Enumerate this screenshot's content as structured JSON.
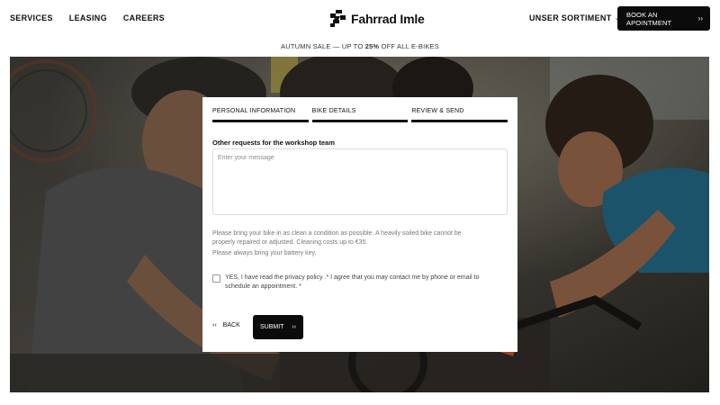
{
  "header": {
    "nav": [
      "SERVICES",
      "LEASING",
      "CAREERS"
    ],
    "logo_text": "Fahrrad Imle",
    "sortiment_label": "UNSER SORTIMENT",
    "sortiment_icon": "chevron-down-icon",
    "book_label": "BOOK AN APOINTMENT",
    "book_arrow": "››"
  },
  "promo": {
    "before": "AUTUMN SALE — UP TO ",
    "highlight": "25%",
    "after": " OFF ALL E-BIKES"
  },
  "hero": {
    "image": "workshop-photo"
  },
  "form": {
    "steps": [
      "PERSONAL INFORMATION",
      "BIKE DETAILS",
      "REVIEW & SEND"
    ],
    "field_label": "Other requests for the workshop team",
    "message_placeholder": "Enter your message",
    "message_value": "",
    "note_clean": "Please bring your bike in as clean a condition as possible. A heavily soiled bike cannot be properly repaired or adjusted. Cleaning costs up to €35.",
    "note_battery": "Please always bring your battery key.",
    "consent_checked": false,
    "consent_text": "YES, I have read the privacy policy .* I agree that you may contact me by phone or email to schedule an appointment. *",
    "back_arrow": "‹‹",
    "back_label": "BACK",
    "submit_label": "SUBMIT",
    "submit_arrow": "››"
  },
  "colors": {
    "accent": "#0b0b0b",
    "text": "#111111",
    "muted": "#777777"
  }
}
